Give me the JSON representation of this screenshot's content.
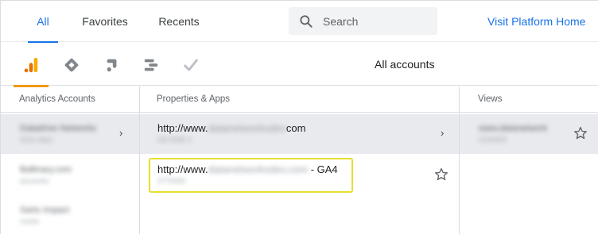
{
  "tabs": [
    {
      "label": "All",
      "active": true
    },
    {
      "label": "Favorites",
      "active": false
    },
    {
      "label": "Recents",
      "active": false
    }
  ],
  "search": {
    "placeholder": "Search",
    "value": "",
    "icon": "search-icon"
  },
  "platform_link": "Visit Platform Home",
  "products": [
    {
      "icon": "analytics-icon",
      "active": true
    },
    {
      "icon": "tag-manager-icon",
      "active": false
    },
    {
      "icon": "optimize-icon",
      "active": false
    },
    {
      "icon": "data-studio-icon",
      "active": false
    },
    {
      "icon": "surveys-check-icon",
      "active": false
    }
  ],
  "products_label": "All accounts",
  "columns": {
    "accounts": {
      "header": "Analytics Accounts",
      "items": [
        {
          "name": "Datadrive Networks",
          "sub": "1011 days",
          "selected": true
        },
        {
          "name": "Ballinary.com",
          "sub": "accounts",
          "selected": false
        },
        {
          "name": "Sartu Impact",
          "sub": "crests",
          "selected": false
        }
      ]
    },
    "properties": {
      "header": "Properties & Apps",
      "items": [
        {
          "url_prefix": "http://www.",
          "url_masked": "datanetworksdev",
          "url_suffix": "com",
          "sub": "UA-9182-1",
          "selected": true
        },
        {
          "url_prefix": "http://www.",
          "url_masked": "datanetworksdev.com",
          "url_suffix": " - GA4",
          "sub": "2770434",
          "selected": false
        }
      ]
    },
    "views": {
      "header": "Views",
      "items": [
        {
          "name": "www.datanetwork",
          "sub": "1234403",
          "selected": true
        }
      ]
    }
  },
  "colors": {
    "accent": "#1a73e8",
    "analytics_orange": "#f29900",
    "highlight_border": "#e6df2e",
    "selected_row": "#e8eaed"
  }
}
